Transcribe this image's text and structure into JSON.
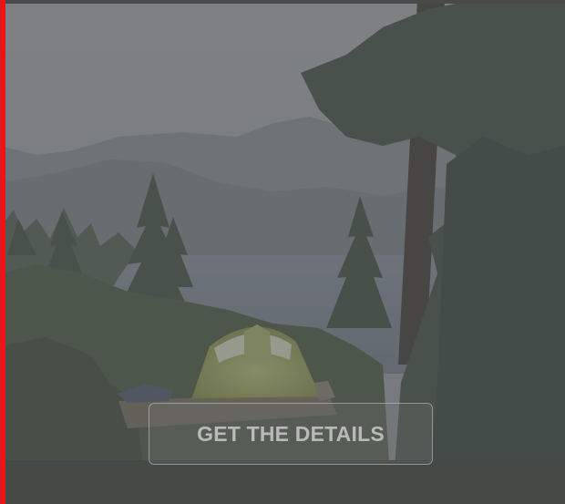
{
  "cta": {
    "label": "GET THE DETAILS"
  },
  "colors": {
    "accent": "#e8151b",
    "overlay": "#585a5c"
  },
  "hero": {
    "scene": "campsite-tent-lake-forest"
  }
}
